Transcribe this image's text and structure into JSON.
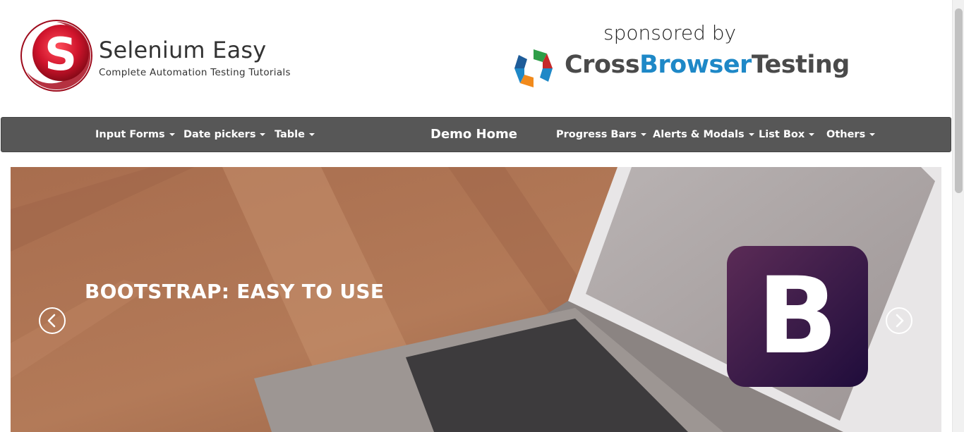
{
  "brand": {
    "title": "Selenium Easy",
    "subtitle": "Complete Automation Testing Tutorials",
    "logo_letter": "S"
  },
  "sponsor": {
    "label": "sponsored by",
    "name_part1": "Cross",
    "name_part2": "Browser",
    "name_part3": "Testing"
  },
  "nav": {
    "left_items": [
      {
        "label": "Input Forms"
      },
      {
        "label": "Date pickers"
      },
      {
        "label": "Table"
      }
    ],
    "home": "Demo Home",
    "right_items": [
      {
        "label": "Progress Bars"
      },
      {
        "label": "Alerts & Modals"
      },
      {
        "label": "List Box"
      },
      {
        "label": "Others"
      }
    ]
  },
  "carousel": {
    "caption": "BOOTSTRAP: EASY TO USE",
    "logo_letter": "B",
    "prev_icon": "chevron-left-icon",
    "next_icon": "chevron-right-icon"
  },
  "colors": {
    "navbar": "#575757",
    "brand_red": "#c8102e",
    "sponsor_blue": "#1e88c7",
    "bootstrap_purple": "#563d7c"
  }
}
